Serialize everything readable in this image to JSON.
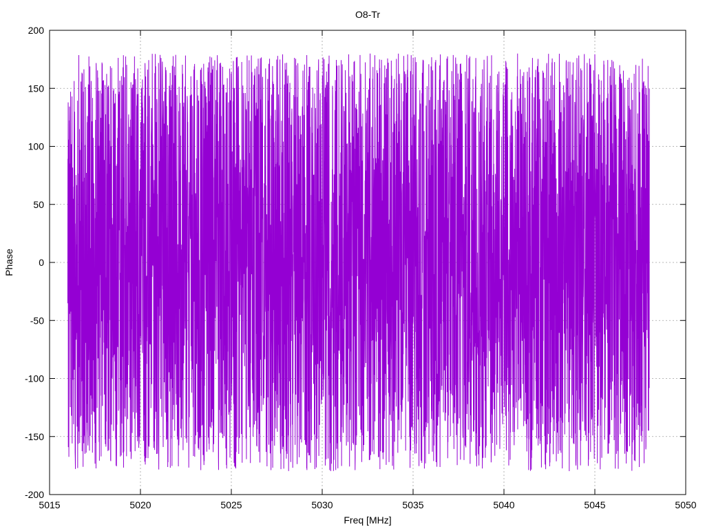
{
  "chart_data": {
    "type": "line",
    "title": "O8-Tr",
    "xlabel": "Freq [MHz]",
    "ylabel": "Phase",
    "xlim": [
      5015,
      5050
    ],
    "ylim": [
      -200,
      200
    ],
    "xticks": [
      "5015",
      "5020",
      "5025",
      "5030",
      "5035",
      "5040",
      "5045",
      "5050"
    ],
    "yticks": [
      "200",
      "150",
      "100",
      "50",
      "0",
      "-50",
      "-100",
      "-150",
      "-200"
    ],
    "grid": true,
    "series": [
      {
        "color": "#9400d3",
        "x_start": 5016.0,
        "x_end": 5048.0,
        "point_count": 4096,
        "y_range": [
          -180,
          180
        ],
        "envelope_note": "wrapped phase, dense oscillation"
      }
    ]
  }
}
